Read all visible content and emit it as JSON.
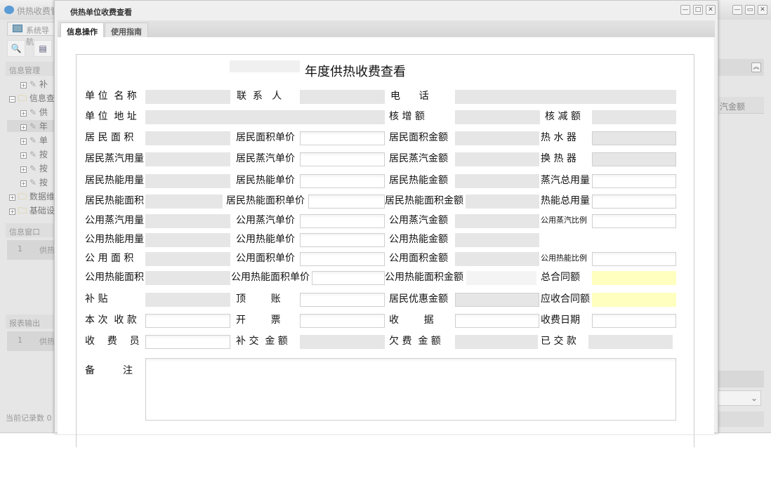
{
  "app": {
    "title": "供热收费管",
    "nav_tab": "系统导航",
    "sections": {
      "info_mgmt": "信息管理",
      "info_window": "信息窗口",
      "report_output": "报表输出"
    },
    "tree": [
      {
        "sign": "+",
        "label": "补",
        "indent": 1,
        "type": "tool"
      },
      {
        "sign": "-",
        "label": "信息查",
        "indent": 0,
        "type": "folder"
      },
      {
        "sign": "+",
        "label": "供",
        "indent": 1,
        "type": "tool"
      },
      {
        "sign": "+",
        "label": "年",
        "indent": 1,
        "type": "tool"
      },
      {
        "sign": "+",
        "label": "单",
        "indent": 1,
        "type": "tool"
      },
      {
        "sign": "+",
        "label": "按",
        "indent": 1,
        "type": "tool"
      },
      {
        "sign": "+",
        "label": "按",
        "indent": 1,
        "type": "tool"
      },
      {
        "sign": "+",
        "label": "按",
        "indent": 1,
        "type": "tool"
      },
      {
        "sign": "+",
        "label": "数据维",
        "indent": 0,
        "type": "folder"
      },
      {
        "sign": "+",
        "label": "基础设",
        "indent": 0,
        "type": "folder"
      }
    ],
    "info_grid": {
      "num": "1",
      "text": "供热"
    },
    "report_grid": {
      "num": "1",
      "text": "供热"
    },
    "column_header": "汽金额",
    "record_count": "当前记录数 0"
  },
  "dialog": {
    "title": "供热单位收费查看",
    "tabs": [
      "信息操作",
      "使用指南"
    ],
    "heading": "年度供热收费查看",
    "rows": [
      [
        {
          "label": "单 位  名 称",
          "type": "gray"
        },
        {
          "label": "联  系   人",
          "type": "gray"
        },
        {
          "label": "电      话",
          "type": "gray"
        }
      ],
      [
        {
          "label": "单 位  地 址",
          "type": "gray"
        },
        {
          "label": "核 增 额",
          "type": "gray"
        },
        {
          "label": "核 减 额",
          "type": "gray"
        }
      ],
      [
        {
          "label": "居 民 面 积",
          "type": "gray"
        },
        {
          "label": "居民面积单价",
          "type": "white"
        },
        {
          "label": "居民面积金额",
          "type": "gray"
        },
        {
          "label": "热 水 器",
          "type": "grayb"
        }
      ],
      [
        {
          "label": "居民蒸汽用量",
          "type": "gray"
        },
        {
          "label": "居民蒸汽单价",
          "type": "white"
        },
        {
          "label": "居民蒸汽金额",
          "type": "gray"
        },
        {
          "label": "换 热 器",
          "type": "grayb"
        }
      ],
      [
        {
          "label": "居民热能用量",
          "type": "gray"
        },
        {
          "label": "居民热能单价",
          "type": "white"
        },
        {
          "label": "居民热能金额",
          "type": "gray"
        },
        {
          "label": "蒸汽总用量",
          "type": "white"
        }
      ],
      [
        {
          "label": "居民热能面积",
          "type": "gray"
        },
        {
          "label": "居民热能面积单价",
          "type": "white"
        },
        {
          "label": "居民热能面积金额",
          "type": "gray"
        },
        {
          "label": "热能总用量",
          "type": "white"
        }
      ],
      [
        {
          "label": "公用蒸汽用量",
          "type": "gray"
        },
        {
          "label": "公用蒸汽单价",
          "type": "white"
        },
        {
          "label": "公用蒸汽金额",
          "type": "gray"
        },
        {
          "label": "公用蒸汽比例",
          "type": "white"
        }
      ],
      [
        {
          "label": "公用热能用量",
          "type": "gray"
        },
        {
          "label": "公用热能单价",
          "type": "white"
        },
        {
          "label": "公用热能金额",
          "type": "gray"
        }
      ],
      [
        {
          "label": "公 用 面 积",
          "type": "gray"
        },
        {
          "label": "公用面积单价",
          "type": "white"
        },
        {
          "label": "公用面积金额",
          "type": "gray"
        },
        {
          "label": "公用热能比例",
          "type": "white"
        }
      ],
      [
        {
          "label": "公用热能面积",
          "type": "gray"
        },
        {
          "label": "公用热能面积单价",
          "type": "white"
        },
        {
          "label": "公用热能面积金额",
          "type": "light"
        },
        {
          "label": "总合同额",
          "type": "yellow"
        }
      ],
      [
        {
          "label": "补 贴",
          "type": "gray"
        },
        {
          "label": "顶        账",
          "type": "white"
        },
        {
          "label": "居民优惠金额",
          "type": "grayb"
        },
        {
          "label": "应收合同额",
          "type": "yellow"
        }
      ],
      [
        {
          "label": "本 次  收 款",
          "type": "white"
        },
        {
          "label": "开        票",
          "type": "white"
        },
        {
          "label": "收        据",
          "type": "white"
        },
        {
          "label": "收费日期",
          "type": "white"
        }
      ],
      [
        {
          "label": "收    费    员",
          "type": "white"
        },
        {
          "label": "补 交  金 额",
          "type": "gray"
        },
        {
          "label": "欠 费  金 额",
          "type": "gray"
        },
        {
          "label": "已 交 款",
          "type": "gray"
        }
      ]
    ],
    "notes_label": "备         注"
  }
}
